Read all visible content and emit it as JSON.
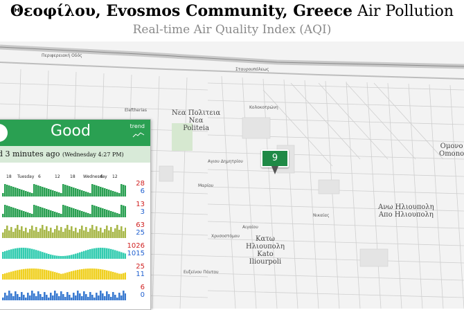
{
  "header": {
    "title_bold": "Θεοφίλου, Evosmos Community, Greece",
    "title_rest": " Air Pollution",
    "subtitle": "Real-time Air Quality Index (AQI)"
  },
  "station": {
    "aqi": "9",
    "marker_color": "#1f8a46"
  },
  "panel": {
    "status": "Good",
    "status_color": "#2aa052",
    "trend_label": "trend",
    "updated": "d 3 minutes ago",
    "updated_when": "(Wednesday 4:27 PM)",
    "axis": [
      "18",
      "Tuesday",
      "6",
      "12",
      "18",
      "Wednesday",
      "6",
      "12"
    ],
    "rows": [
      {
        "name": "pm25",
        "max": "28",
        "min": "6",
        "color": "#2aa052"
      },
      {
        "name": "pm10",
        "max": "13",
        "min": "3",
        "color": "#2aa052"
      },
      {
        "name": "o3",
        "max": "63",
        "min": "25",
        "color": "#a8b84a"
      },
      {
        "name": "t",
        "max": "1026",
        "min": "1015",
        "color": "#33ccb0"
      },
      {
        "name": "temp",
        "max": "25",
        "min": "11",
        "color": "#f0d020"
      },
      {
        "name": "w",
        "max": "6",
        "min": "0",
        "color": "#3a7ad0"
      }
    ]
  },
  "map_labels": [
    {
      "text": "Νεα Πολιτεια\nΝεα\nPoliteia",
      "kind": "big"
    },
    {
      "text": "Κατω\nΗλιουπολη\nKato\nIliourpoli",
      "kind": "big"
    },
    {
      "text": "Ανω Ηλιουπολη\nΑπο Ηλιουπολη",
      "kind": "big"
    },
    {
      "text": "Ομονο\nOmono",
      "kind": "big"
    },
    {
      "text": "Περιφερειακή Οδός",
      "kind": "small"
    },
    {
      "text": "Σταυρουπόλεως",
      "kind": "small"
    },
    {
      "text": "Eleftherias",
      "kind": "small"
    },
    {
      "text": "Κολοκοτρώνη",
      "kind": "small"
    },
    {
      "text": "Αγιου Δημητρίου",
      "kind": "small"
    },
    {
      "text": "Μαρίου",
      "kind": "small"
    },
    {
      "text": "Αιγαίου",
      "kind": "small"
    },
    {
      "text": "Ευξείνου Πόντου",
      "kind": "small"
    },
    {
      "text": "Νικαίας",
      "kind": "small"
    },
    {
      "text": "Χρυσοστόμου",
      "kind": "small"
    }
  ]
}
